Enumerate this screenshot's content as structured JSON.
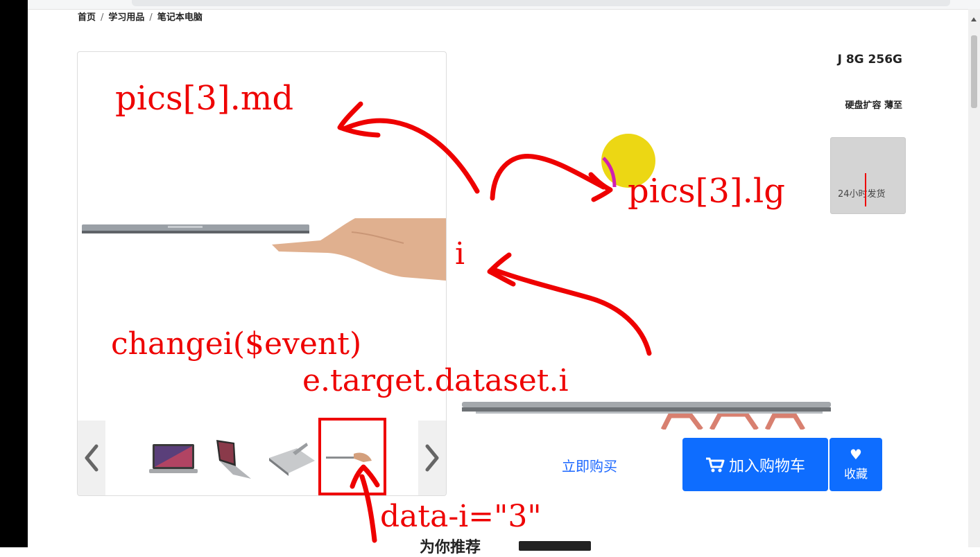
{
  "breadcrumb": [
    "首页",
    "学习用品",
    "笔记本电脑"
  ],
  "gallery": {
    "prev_icon": "chevron-left-icon",
    "next_icon": "chevron-right-icon",
    "thumbnails": [
      "laptop-front",
      "laptop-angle",
      "laptop-open-flat",
      "laptop-held-in-hand"
    ],
    "selected_thumbnail": 3
  },
  "product": {
    "spec_title": "J 8G 256G",
    "spec_desc": "硬盘扩容 薄至",
    "shipping_tag": "24小时发货"
  },
  "actions": {
    "buy_now": "立即购买",
    "add_to_cart": "加入购物车",
    "favorite": "收藏",
    "cart_icon": "cart-icon",
    "heart_icon": "heart-icon"
  },
  "recommend": {
    "title": "为你推荐"
  },
  "annotations": {
    "md": "pics[3].md",
    "lg": "pics[3].lg",
    "index": "i",
    "handler": "changei($event)",
    "dataset": "e.target.dataset.i",
    "data_attr": "data-i=\"3\""
  },
  "colors": {
    "primary": "#0e6dff",
    "annotation": "#ee0000",
    "highlight": "#ead400"
  }
}
